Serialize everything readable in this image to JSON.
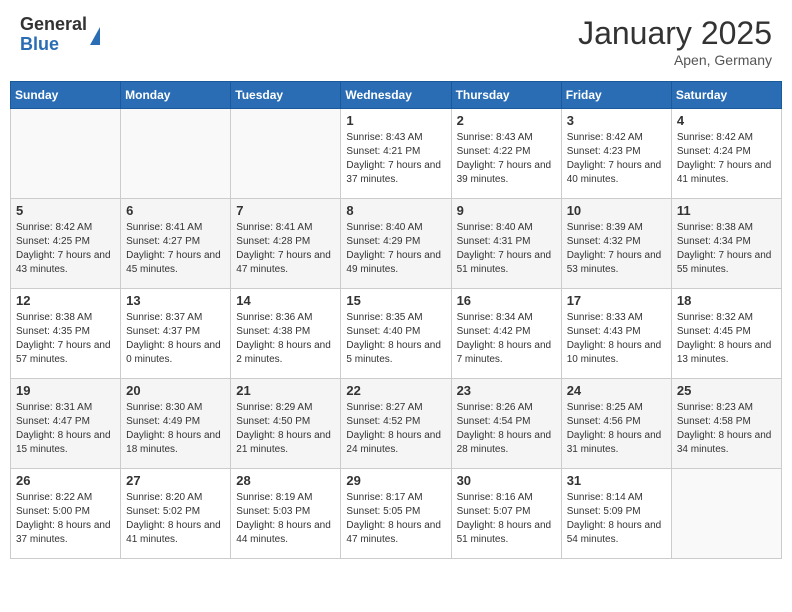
{
  "header": {
    "logo_general": "General",
    "logo_blue": "Blue",
    "month_title": "January 2025",
    "location": "Apen, Germany"
  },
  "days_of_week": [
    "Sunday",
    "Monday",
    "Tuesday",
    "Wednesday",
    "Thursday",
    "Friday",
    "Saturday"
  ],
  "weeks": [
    [
      {
        "day": "",
        "sunrise": "",
        "sunset": "",
        "daylight": "",
        "empty": true
      },
      {
        "day": "",
        "sunrise": "",
        "sunset": "",
        "daylight": "",
        "empty": true
      },
      {
        "day": "",
        "sunrise": "",
        "sunset": "",
        "daylight": "",
        "empty": true
      },
      {
        "day": "1",
        "sunrise": "Sunrise: 8:43 AM",
        "sunset": "Sunset: 4:21 PM",
        "daylight": "Daylight: 7 hours and 37 minutes.",
        "empty": false
      },
      {
        "day": "2",
        "sunrise": "Sunrise: 8:43 AM",
        "sunset": "Sunset: 4:22 PM",
        "daylight": "Daylight: 7 hours and 39 minutes.",
        "empty": false
      },
      {
        "day": "3",
        "sunrise": "Sunrise: 8:42 AM",
        "sunset": "Sunset: 4:23 PM",
        "daylight": "Daylight: 7 hours and 40 minutes.",
        "empty": false
      },
      {
        "day": "4",
        "sunrise": "Sunrise: 8:42 AM",
        "sunset": "Sunset: 4:24 PM",
        "daylight": "Daylight: 7 hours and 41 minutes.",
        "empty": false
      }
    ],
    [
      {
        "day": "5",
        "sunrise": "Sunrise: 8:42 AM",
        "sunset": "Sunset: 4:25 PM",
        "daylight": "Daylight: 7 hours and 43 minutes.",
        "empty": false
      },
      {
        "day": "6",
        "sunrise": "Sunrise: 8:41 AM",
        "sunset": "Sunset: 4:27 PM",
        "daylight": "Daylight: 7 hours and 45 minutes.",
        "empty": false
      },
      {
        "day": "7",
        "sunrise": "Sunrise: 8:41 AM",
        "sunset": "Sunset: 4:28 PM",
        "daylight": "Daylight: 7 hours and 47 minutes.",
        "empty": false
      },
      {
        "day": "8",
        "sunrise": "Sunrise: 8:40 AM",
        "sunset": "Sunset: 4:29 PM",
        "daylight": "Daylight: 7 hours and 49 minutes.",
        "empty": false
      },
      {
        "day": "9",
        "sunrise": "Sunrise: 8:40 AM",
        "sunset": "Sunset: 4:31 PM",
        "daylight": "Daylight: 7 hours and 51 minutes.",
        "empty": false
      },
      {
        "day": "10",
        "sunrise": "Sunrise: 8:39 AM",
        "sunset": "Sunset: 4:32 PM",
        "daylight": "Daylight: 7 hours and 53 minutes.",
        "empty": false
      },
      {
        "day": "11",
        "sunrise": "Sunrise: 8:38 AM",
        "sunset": "Sunset: 4:34 PM",
        "daylight": "Daylight: 7 hours and 55 minutes.",
        "empty": false
      }
    ],
    [
      {
        "day": "12",
        "sunrise": "Sunrise: 8:38 AM",
        "sunset": "Sunset: 4:35 PM",
        "daylight": "Daylight: 7 hours and 57 minutes.",
        "empty": false
      },
      {
        "day": "13",
        "sunrise": "Sunrise: 8:37 AM",
        "sunset": "Sunset: 4:37 PM",
        "daylight": "Daylight: 8 hours and 0 minutes.",
        "empty": false
      },
      {
        "day": "14",
        "sunrise": "Sunrise: 8:36 AM",
        "sunset": "Sunset: 4:38 PM",
        "daylight": "Daylight: 8 hours and 2 minutes.",
        "empty": false
      },
      {
        "day": "15",
        "sunrise": "Sunrise: 8:35 AM",
        "sunset": "Sunset: 4:40 PM",
        "daylight": "Daylight: 8 hours and 5 minutes.",
        "empty": false
      },
      {
        "day": "16",
        "sunrise": "Sunrise: 8:34 AM",
        "sunset": "Sunset: 4:42 PM",
        "daylight": "Daylight: 8 hours and 7 minutes.",
        "empty": false
      },
      {
        "day": "17",
        "sunrise": "Sunrise: 8:33 AM",
        "sunset": "Sunset: 4:43 PM",
        "daylight": "Daylight: 8 hours and 10 minutes.",
        "empty": false
      },
      {
        "day": "18",
        "sunrise": "Sunrise: 8:32 AM",
        "sunset": "Sunset: 4:45 PM",
        "daylight": "Daylight: 8 hours and 13 minutes.",
        "empty": false
      }
    ],
    [
      {
        "day": "19",
        "sunrise": "Sunrise: 8:31 AM",
        "sunset": "Sunset: 4:47 PM",
        "daylight": "Daylight: 8 hours and 15 minutes.",
        "empty": false
      },
      {
        "day": "20",
        "sunrise": "Sunrise: 8:30 AM",
        "sunset": "Sunset: 4:49 PM",
        "daylight": "Daylight: 8 hours and 18 minutes.",
        "empty": false
      },
      {
        "day": "21",
        "sunrise": "Sunrise: 8:29 AM",
        "sunset": "Sunset: 4:50 PM",
        "daylight": "Daylight: 8 hours and 21 minutes.",
        "empty": false
      },
      {
        "day": "22",
        "sunrise": "Sunrise: 8:27 AM",
        "sunset": "Sunset: 4:52 PM",
        "daylight": "Daylight: 8 hours and 24 minutes.",
        "empty": false
      },
      {
        "day": "23",
        "sunrise": "Sunrise: 8:26 AM",
        "sunset": "Sunset: 4:54 PM",
        "daylight": "Daylight: 8 hours and 28 minutes.",
        "empty": false
      },
      {
        "day": "24",
        "sunrise": "Sunrise: 8:25 AM",
        "sunset": "Sunset: 4:56 PM",
        "daylight": "Daylight: 8 hours and 31 minutes.",
        "empty": false
      },
      {
        "day": "25",
        "sunrise": "Sunrise: 8:23 AM",
        "sunset": "Sunset: 4:58 PM",
        "daylight": "Daylight: 8 hours and 34 minutes.",
        "empty": false
      }
    ],
    [
      {
        "day": "26",
        "sunrise": "Sunrise: 8:22 AM",
        "sunset": "Sunset: 5:00 PM",
        "daylight": "Daylight: 8 hours and 37 minutes.",
        "empty": false
      },
      {
        "day": "27",
        "sunrise": "Sunrise: 8:20 AM",
        "sunset": "Sunset: 5:02 PM",
        "daylight": "Daylight: 8 hours and 41 minutes.",
        "empty": false
      },
      {
        "day": "28",
        "sunrise": "Sunrise: 8:19 AM",
        "sunset": "Sunset: 5:03 PM",
        "daylight": "Daylight: 8 hours and 44 minutes.",
        "empty": false
      },
      {
        "day": "29",
        "sunrise": "Sunrise: 8:17 AM",
        "sunset": "Sunset: 5:05 PM",
        "daylight": "Daylight: 8 hours and 47 minutes.",
        "empty": false
      },
      {
        "day": "30",
        "sunrise": "Sunrise: 8:16 AM",
        "sunset": "Sunset: 5:07 PM",
        "daylight": "Daylight: 8 hours and 51 minutes.",
        "empty": false
      },
      {
        "day": "31",
        "sunrise": "Sunrise: 8:14 AM",
        "sunset": "Sunset: 5:09 PM",
        "daylight": "Daylight: 8 hours and 54 minutes.",
        "empty": false
      },
      {
        "day": "",
        "sunrise": "",
        "sunset": "",
        "daylight": "",
        "empty": true
      }
    ]
  ]
}
